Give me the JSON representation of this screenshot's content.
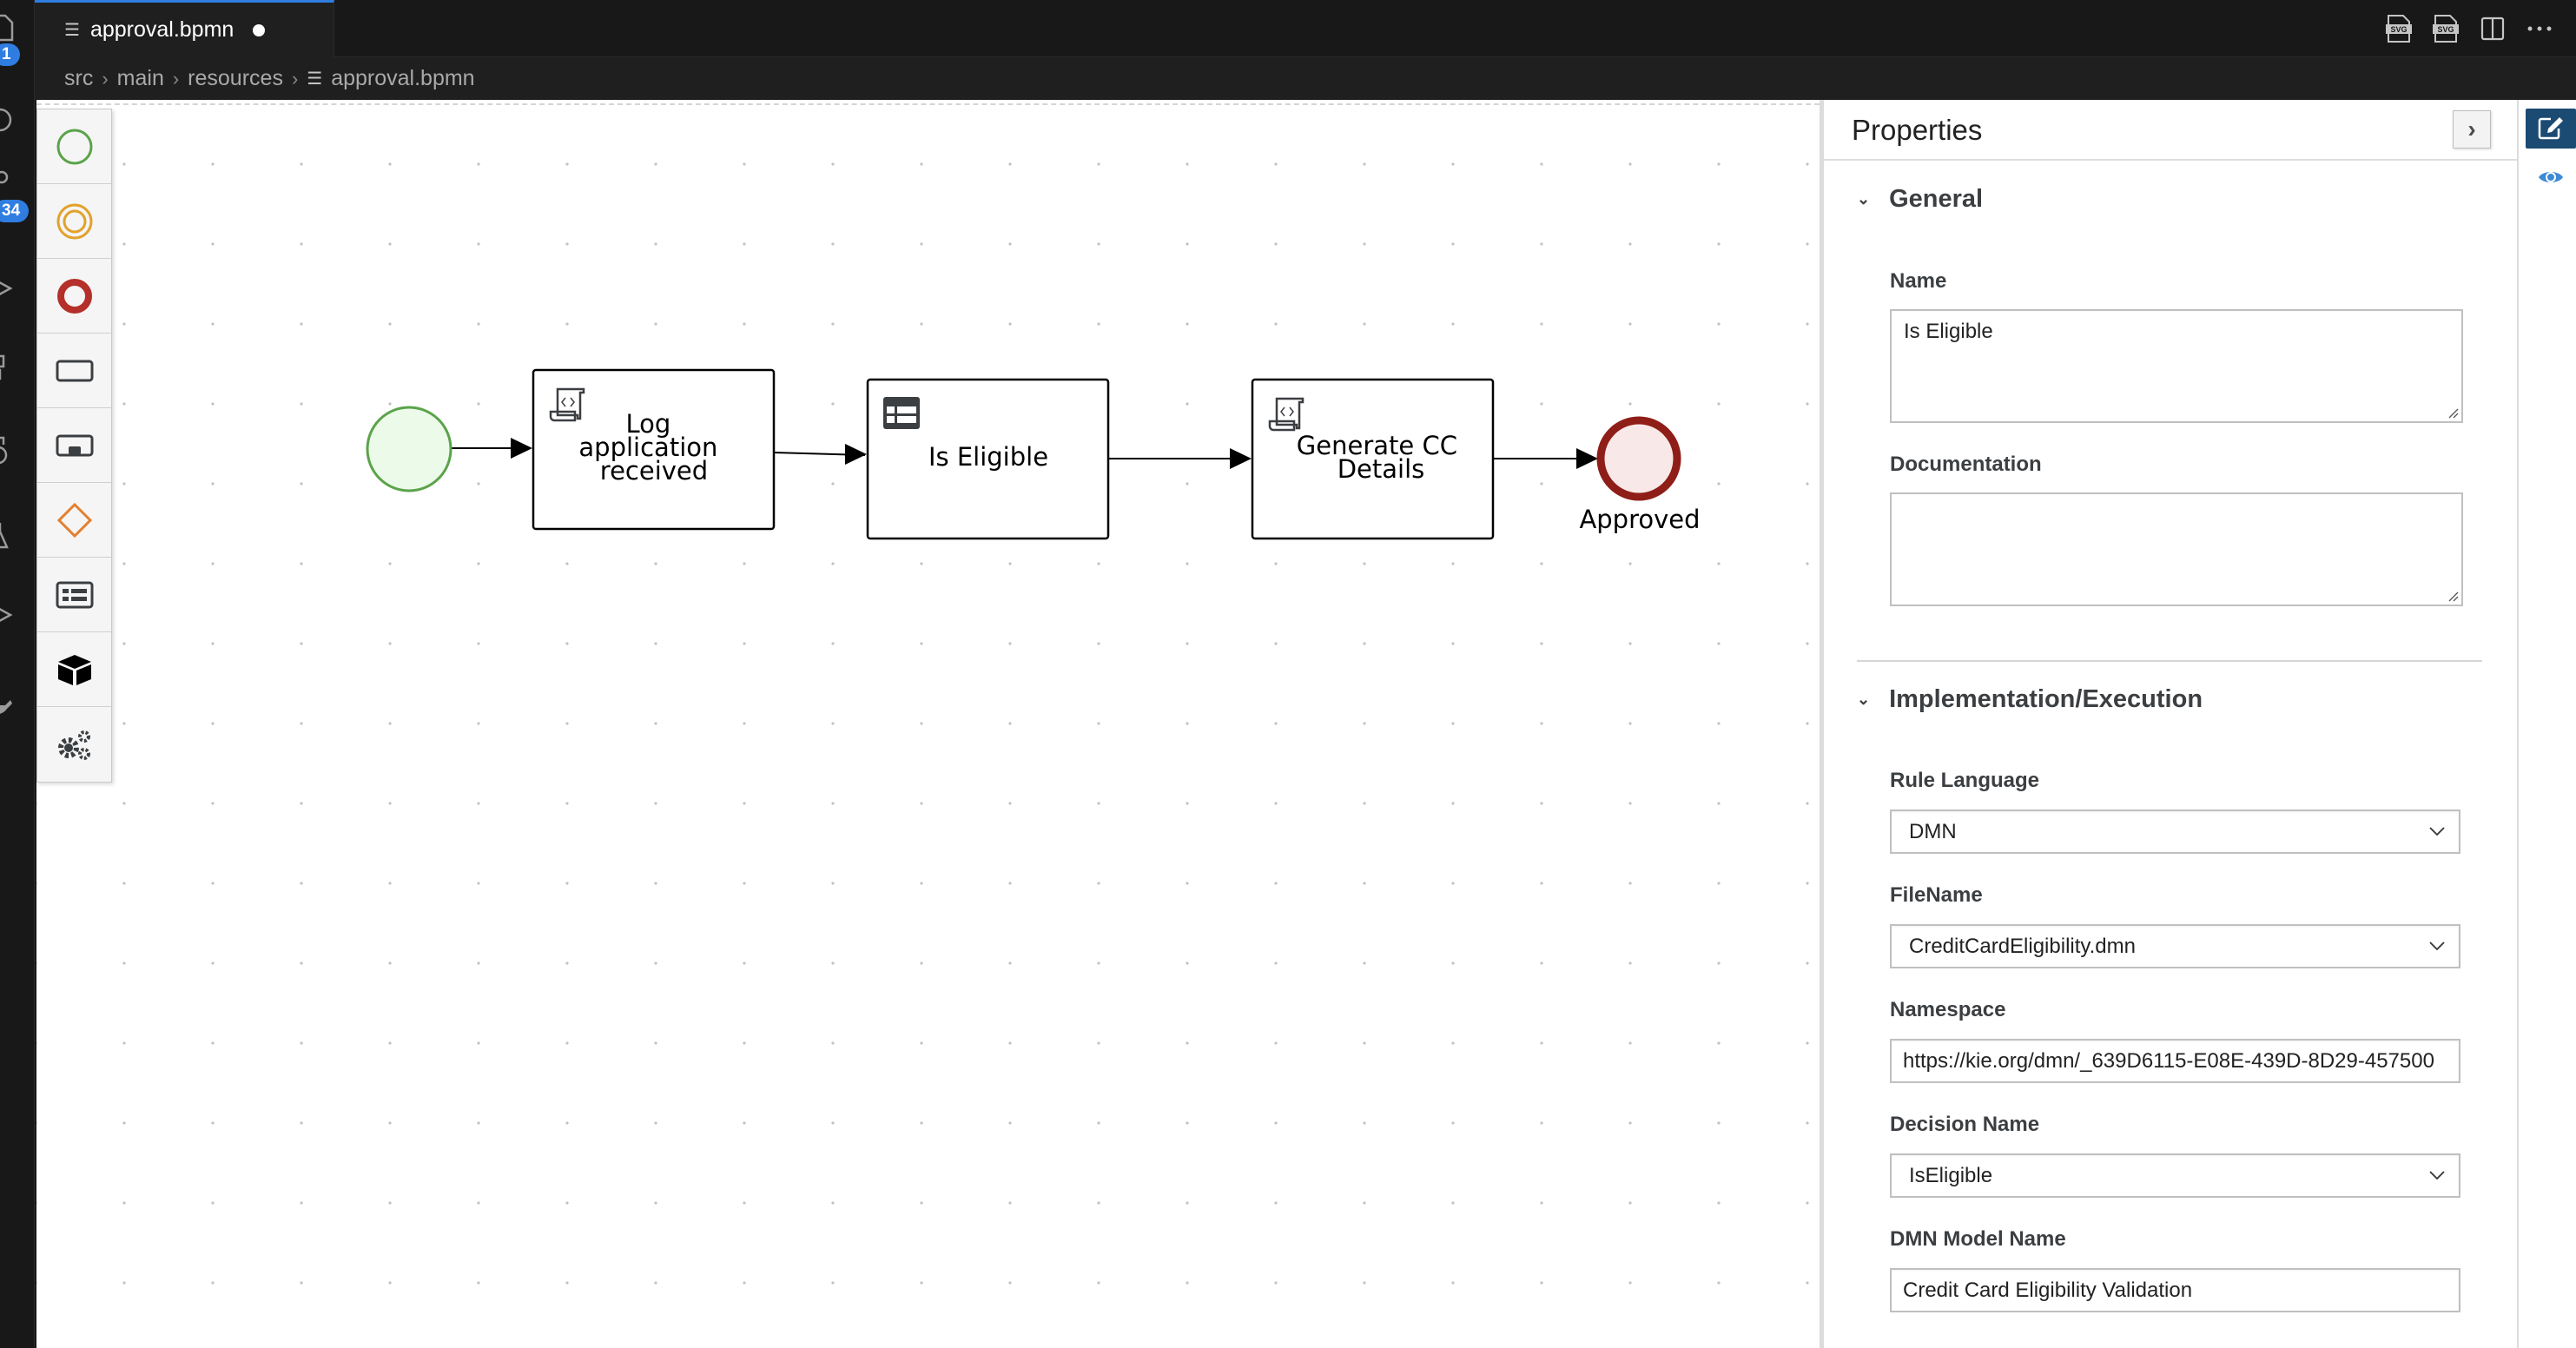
{
  "editor": {
    "tab": {
      "label": "approval.bpmn",
      "dirty": true,
      "icon": "file-lines-icon"
    },
    "tab_actions": [
      {
        "name": "export-svg-icon",
        "label": "SVG"
      },
      {
        "name": "export-svg-alt-icon",
        "label": "SVG"
      },
      {
        "name": "split-editor-icon"
      },
      {
        "name": "more-actions-icon"
      }
    ],
    "breadcrumb": [
      "src",
      "main",
      "resources",
      "approval.bpmn"
    ]
  },
  "activity_bar": {
    "badges": {
      "explorer": "1",
      "source_control": "34"
    },
    "colors": {
      "badge": "#2f7de1"
    }
  },
  "palette": {
    "items": [
      {
        "name": "start-event-icon",
        "label": "Start Events"
      },
      {
        "name": "intermediate-event-icon",
        "label": "Intermediate Events"
      },
      {
        "name": "end-event-icon",
        "label": "End Events"
      },
      {
        "name": "task-icon",
        "label": "Activities"
      },
      {
        "name": "subprocess-icon",
        "label": "Subprocesses"
      },
      {
        "name": "gateway-icon",
        "label": "Gateways"
      },
      {
        "name": "container-icon",
        "label": "Containers"
      },
      {
        "name": "artifacts-icon",
        "label": "Artifacts"
      },
      {
        "name": "custom-tasks-icon",
        "label": "Custom Tasks"
      }
    ]
  },
  "diagram": {
    "nodes": [
      {
        "id": "start",
        "type": "start-event",
        "label": ""
      },
      {
        "id": "log",
        "type": "script-task",
        "label_lines": [
          "Log",
          "application",
          "received"
        ]
      },
      {
        "id": "eligible",
        "type": "business-rule-task",
        "label_lines": [
          "Is Eligible"
        ]
      },
      {
        "id": "generate",
        "type": "script-task",
        "label_lines": [
          "Generate CC",
          "Details"
        ]
      },
      {
        "id": "approved",
        "type": "end-event",
        "label": "Approved"
      }
    ],
    "edges": [
      {
        "from": "start",
        "to": "log"
      },
      {
        "from": "log",
        "to": "eligible"
      },
      {
        "from": "eligible",
        "to": "generate"
      },
      {
        "from": "generate",
        "to": "approved"
      }
    ],
    "colors": {
      "start_stroke": "#5ba34a",
      "start_fill": "#ecfaea",
      "end_stroke": "#8e1e17",
      "end_fill": "#f9e8e8"
    }
  },
  "properties": {
    "title": "Properties",
    "collapse_label": "›",
    "sections": {
      "general": {
        "title": "General",
        "name_label": "Name",
        "name_value": "Is Eligible",
        "documentation_label": "Documentation",
        "documentation_value": ""
      },
      "implementation": {
        "title": "Implementation/Execution",
        "rule_language_label": "Rule Language",
        "rule_language_value": "DMN",
        "filename_label": "FileName",
        "filename_value": "CreditCardEligibility.dmn",
        "namespace_label": "Namespace",
        "namespace_value": "https://kie.org/dmn/_639D6115-E08E-439D-8D29-457500",
        "decision_name_label": "Decision Name",
        "decision_name_value": "IsEligible",
        "dmn_model_name_label": "DMN Model Name",
        "dmn_model_name_value": "Credit Card Eligibility Validation"
      }
    }
  },
  "side_strip": {
    "items": [
      {
        "name": "edit-properties-icon",
        "active": true
      },
      {
        "name": "preview-icon",
        "active": false
      }
    ]
  }
}
